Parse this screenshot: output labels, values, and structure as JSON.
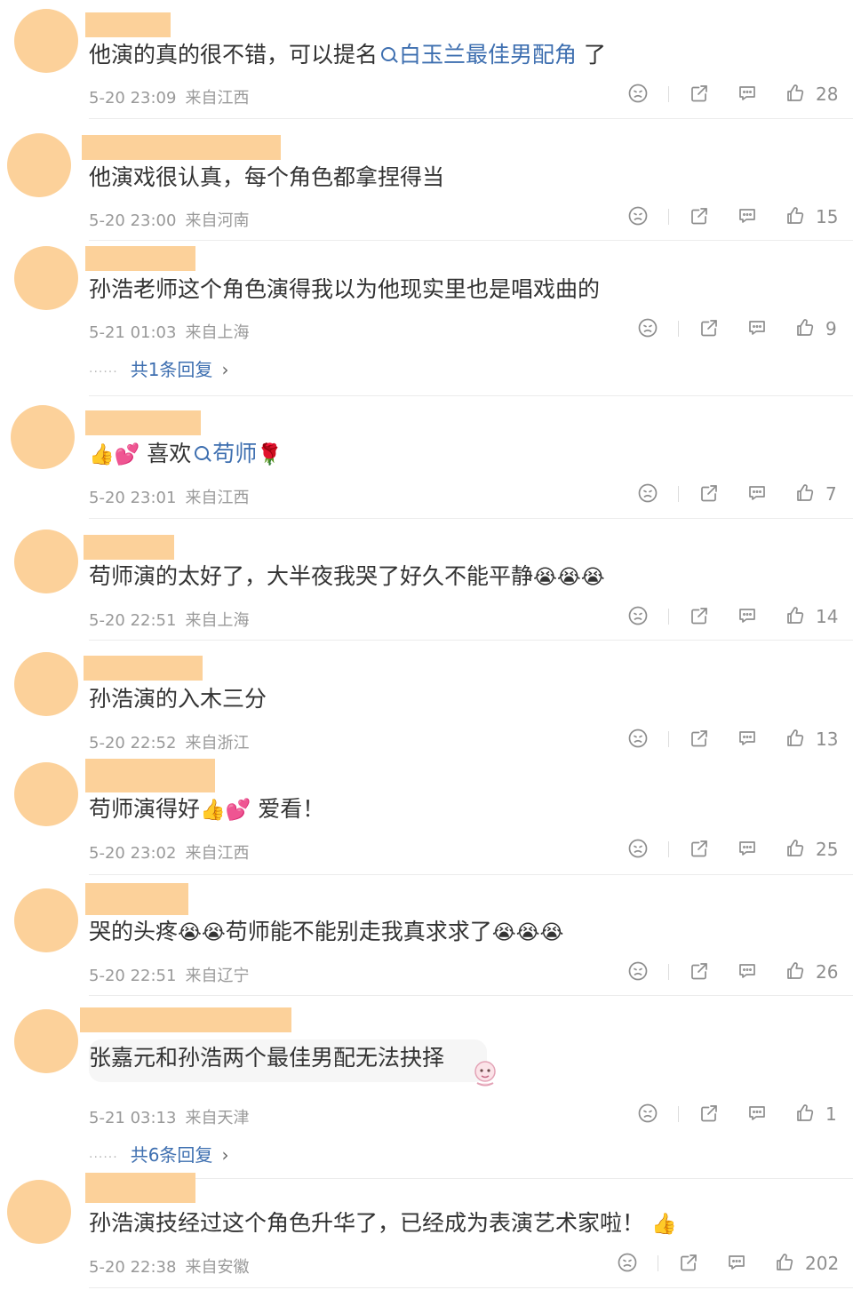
{
  "comments": [
    {
      "text_parts": [
        "他演的真的很不错，可以提名",
        "白玉兰最佳男配角",
        " 了"
      ],
      "time": "5-20 23:09",
      "location": "来自江西",
      "likes": "28"
    },
    {
      "text": "他演戏很认真，每个角色都拿捏得当",
      "time": "5-20 23:00",
      "location": "来自河南",
      "likes": "15"
    },
    {
      "text": "孙浩老师这个角色演得我以为他现实里也是唱戏曲的",
      "time": "5-21 01:03",
      "location": "来自上海",
      "likes": "9",
      "replies": "共1条回复"
    },
    {
      "emoji_lead": "👍💕",
      "text_parts": [
        " 喜欢",
        "苟师",
        " 🌹"
      ],
      "time": "5-20 23:01",
      "location": "来自江西",
      "likes": "7"
    },
    {
      "text": "苟师演的太好了，大半夜我哭了好久不能平静",
      "emoji_tail": "😭😭😭",
      "time": "5-20 22:51",
      "location": "来自上海",
      "likes": "14"
    },
    {
      "text": "孙浩演的入木三分",
      "time": "5-20 22:52",
      "location": "来自浙江",
      "likes": "13"
    },
    {
      "text": "苟师演得好",
      "emoji_tail": "👍💕",
      "text_after": " 爱看！",
      "time": "5-20 23:02",
      "location": "来自江西",
      "likes": "25"
    },
    {
      "text": "哭的头疼",
      "emoji_mid": "😭😭",
      "text_after": "苟师能不能别走我真求求了",
      "emoji_tail": "😭😭😭",
      "time": "5-20 22:51",
      "location": "来自辽宁",
      "likes": "26"
    },
    {
      "text": "张嘉元和孙浩两个最佳男配无法抉择",
      "time": "5-21 03:13",
      "location": "来自天津",
      "likes": "1",
      "replies": "共6条回复"
    },
    {
      "text": "孙浩演技经过这个角色升华了，已经成为表演艺术家啦！",
      "emoji_tail": "👍",
      "time": "5-20 22:38",
      "location": "来自安徽",
      "likes": "202"
    }
  ],
  "icons": {
    "dislike": "dislike-face-icon",
    "share": "share-icon",
    "comment": "comment-icon",
    "like": "thumbs-up-icon",
    "chevron": "chevron-right-icon"
  },
  "colors": {
    "avatar": "#fcd19a",
    "link": "#3e6fb0",
    "meta": "#999999"
  }
}
